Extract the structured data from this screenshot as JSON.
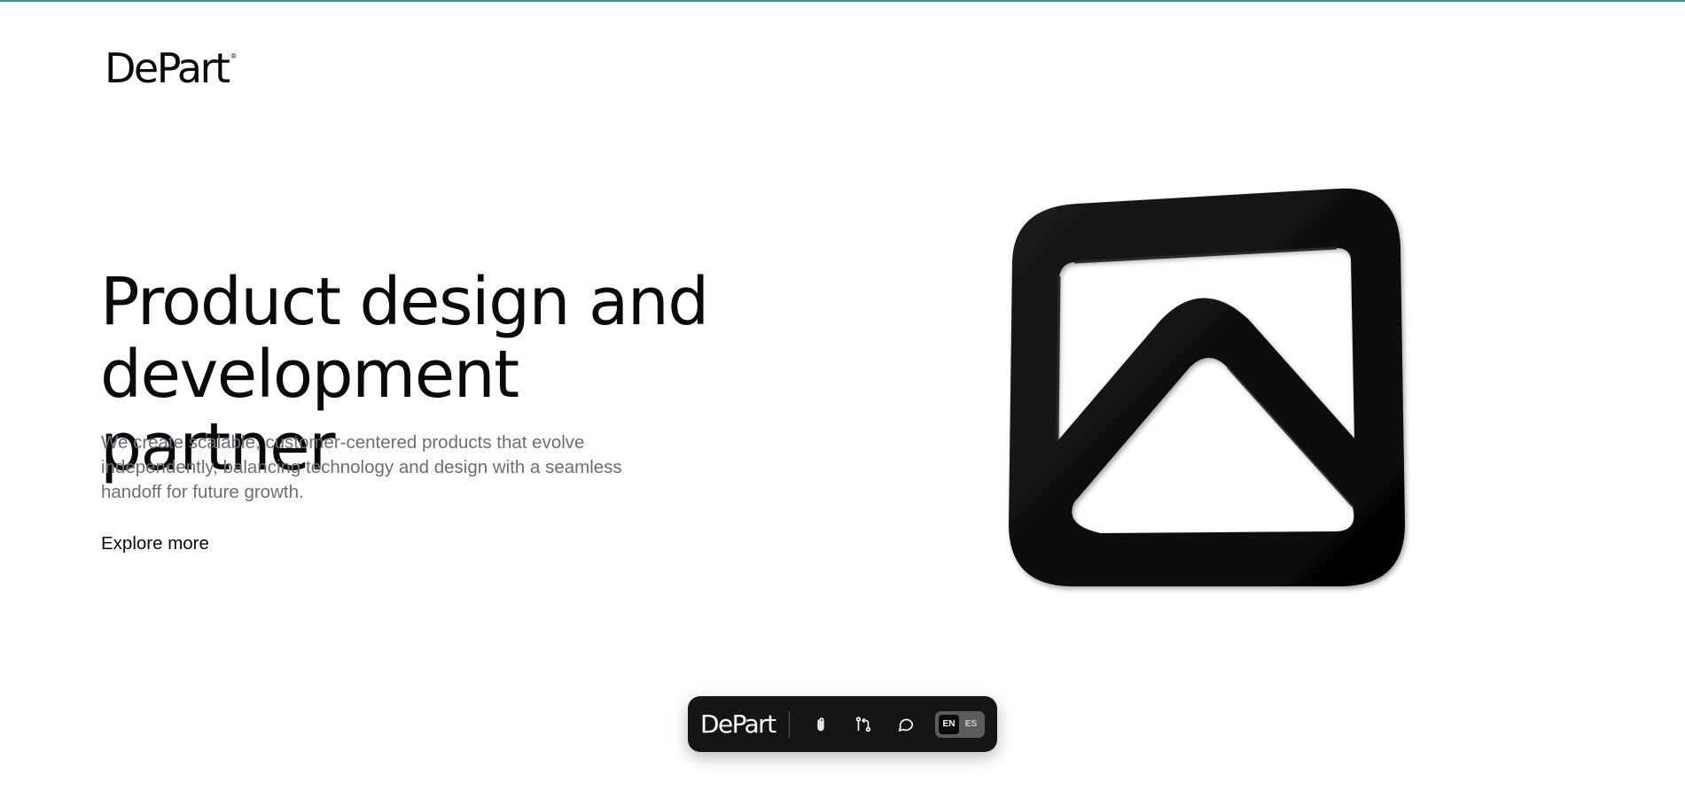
{
  "brand": {
    "name": "DePart",
    "trademark": "®"
  },
  "hero": {
    "title_line1": "Product design and",
    "title_line2": "development partner",
    "description": "We create scalable, customer-centered products that evolve independently, balancing technology and design with a seamless handoff for future growth.",
    "cta_label": "Explore more",
    "artwork_icon": "image-placeholder-icon"
  },
  "dock": {
    "logo": "DePart",
    "actions": [
      {
        "icon": "paperclip-icon"
      },
      {
        "icon": "git-pull-request-icon"
      },
      {
        "icon": "chat-bubble-icon"
      }
    ],
    "languages": [
      "EN",
      "ES"
    ],
    "active_language": "EN"
  },
  "colors": {
    "accent_rule": "#4a8a96",
    "text_primary": "#0a0a0a",
    "text_muted": "#6b6e78",
    "dock_bg": "#151515"
  }
}
